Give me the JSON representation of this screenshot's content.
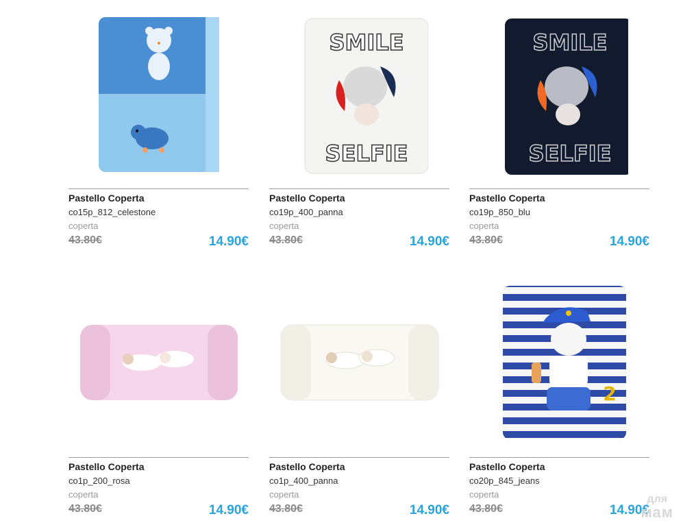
{
  "products": [
    {
      "brand": "Pastello Coperta",
      "code": "co15p_812_celestone",
      "category": "coperta",
      "old_price": "43.80€",
      "price": "14.90€",
      "image": "blue-bear-elephant-blanket"
    },
    {
      "brand": "Pastello Coperta",
      "code": "co19p_400_panna",
      "category": "coperta",
      "old_price": "43.80€",
      "price": "14.90€",
      "image": "white-smile-selfie-blanket",
      "print_top": "SMILE",
      "print_bottom": "SELFIE"
    },
    {
      "brand": "Pastello Coperta",
      "code": "co19p_850_blu",
      "category": "coperta",
      "old_price": "43.80€",
      "price": "14.90€",
      "image": "navy-smile-selfie-blanket",
      "print_top": "SMILE",
      "print_bottom": "SELFIE"
    },
    {
      "brand": "Pastello Coperta",
      "code": "co1p_200_rosa",
      "category": "coperta",
      "old_price": "43.80€",
      "price": "14.90€",
      "image": "pink-sleeping-bears-blanket"
    },
    {
      "brand": "Pastello Coperta",
      "code": "co1p_400_panna",
      "category": "coperta",
      "old_price": "43.80€",
      "price": "14.90€",
      "image": "cream-sleeping-bears-blanket"
    },
    {
      "brand": "Pastello Coperta",
      "code": "co20p_845_jeans",
      "category": "coperta",
      "old_price": "43.80€",
      "price": "14.90€",
      "image": "striped-dog-cap-blanket",
      "patch_number": "2"
    }
  ],
  "watermark": {
    "line1": "для",
    "line2": "мам"
  },
  "colors": {
    "accent": "#2aa4dc",
    "old_price": "#8a8a8a",
    "category": "#9a9a9a"
  }
}
